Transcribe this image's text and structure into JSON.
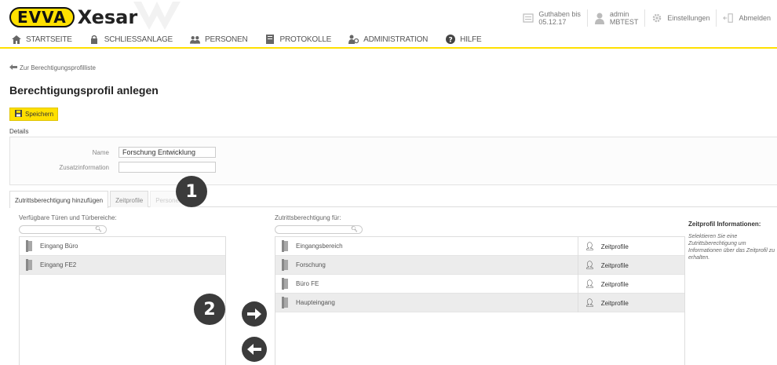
{
  "header": {
    "logo_brand": "EVVA",
    "logo_product": "Xesar",
    "credit": {
      "label": "Guthaben bis",
      "value": "05.12.17"
    },
    "user": {
      "name": "admin",
      "site": "MBTEST"
    },
    "settings_label": "Einstellungen",
    "logout_label": "Abmelden"
  },
  "nav": {
    "items": [
      {
        "label": "Startseite",
        "icon": "home-icon"
      },
      {
        "label": "Schliessanlage",
        "icon": "lock-icon"
      },
      {
        "label": "Personen",
        "icon": "people-icon"
      },
      {
        "label": "Protokolle",
        "icon": "book-icon"
      },
      {
        "label": "Administration",
        "icon": "admin-icon"
      },
      {
        "label": "Hilfe",
        "icon": "help-icon"
      }
    ]
  },
  "breadcrumb": {
    "back_label": "Zur Berechtigungsprofilliste"
  },
  "page": {
    "title": "Berechtigungsprofil anlegen",
    "save_label": "Speichern"
  },
  "details": {
    "section_label": "Details",
    "name_label": "Name",
    "name_value": "Forschung Entwicklung",
    "info_label": "Zusatzinformation",
    "info_value": ""
  },
  "tabs": [
    {
      "label": "Zutrittsberechtigung hinzufügen",
      "active": true
    },
    {
      "label": "Zeitprofile",
      "active": false
    },
    {
      "label": "Personen",
      "active": false
    }
  ],
  "available": {
    "label": "Verfügbare Türen und Türbereiche:",
    "items": [
      "Eingang Büro",
      "Eingang FE2"
    ]
  },
  "assigned": {
    "label": "Zutrittsberechtigung für:",
    "zeitprofile_label": "Zeitprofile",
    "items": [
      "Eingangsbereich",
      "Forschung",
      "Büro FE",
      "Haupteingang"
    ]
  },
  "zeitprofil_info": {
    "title": "Zeitprofil Informationen:",
    "text": "Selektieren Sie eine Zutrittsberechtigung um Informationen über das Zeitprofil zu erhalten."
  },
  "annotations": {
    "badge1": "1",
    "badge2": "2"
  },
  "colors": {
    "accent": "#ffe000",
    "dark": "#3b3b3b"
  }
}
